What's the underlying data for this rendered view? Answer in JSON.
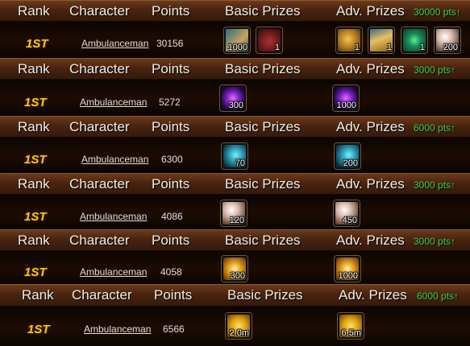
{
  "sections": [
    {
      "header": {
        "rank": "Rank",
        "character": "Character",
        "points": "Points",
        "basic": "Basic Prizes",
        "adv": "Adv. Prizes",
        "threshold": "30000 pts↑"
      },
      "entry": {
        "rank": "1ST",
        "character": "Ambulanceman",
        "points": "30156"
      },
      "basic_prizes": [
        {
          "icon": "scroll-icon",
          "qty": "1000"
        },
        {
          "icon": "chest-icon",
          "qty": "1"
        }
      ],
      "adv_prizes": [
        {
          "icon": "lion-icon",
          "qty": "1"
        },
        {
          "icon": "gold-scroll-icon",
          "qty": "1"
        },
        {
          "icon": "gem-icon",
          "qty": "1"
        },
        {
          "icon": "pearl-icon",
          "qty": "200"
        }
      ]
    },
    {
      "header": {
        "rank": "Rank",
        "character": "Character",
        "points": "Points",
        "basic": "Basic Prizes",
        "adv": "Adv. Prizes",
        "threshold": "3000 pts↑"
      },
      "entry": {
        "rank": "1ST",
        "character": "Ambulanceman",
        "points": "5272"
      },
      "basic_prizes": [
        {
          "icon": "orb-icon",
          "qty": "300"
        }
      ],
      "adv_prizes": [
        {
          "icon": "orb-icon",
          "qty": "1000"
        }
      ]
    },
    {
      "header": {
        "rank": "Rank",
        "character": "Character",
        "points": "Points",
        "basic": "Basic Prizes",
        "adv": "Adv. Prizes",
        "threshold": "6000 pts↑"
      },
      "entry": {
        "rank": "1ST",
        "character": "Ambulanceman",
        "points": "6300"
      },
      "basic_prizes": [
        {
          "icon": "potion-icon",
          "qty": "70"
        }
      ],
      "adv_prizes": [
        {
          "icon": "potion-icon",
          "qty": "200"
        }
      ]
    },
    {
      "header": {
        "rank": "Rank",
        "character": "Character",
        "points": "Points",
        "basic": "Basic Prizes",
        "adv": "Adv. Prizes",
        "threshold": "3000 pts↑"
      },
      "entry": {
        "rank": "1ST",
        "character": "Ambulanceman",
        "points": "4086"
      },
      "basic_prizes": [
        {
          "icon": "pearl-icon",
          "qty": "120"
        }
      ],
      "adv_prizes": [
        {
          "icon": "pearl-icon",
          "qty": "450"
        }
      ]
    },
    {
      "header": {
        "rank": "Rank",
        "character": "Character",
        "points": "Points",
        "basic": "Basic Prizes",
        "adv": "Adv. Prizes",
        "threshold": "3000 pts↑"
      },
      "entry": {
        "rank": "1ST",
        "character": "Ambulanceman",
        "points": "4058"
      },
      "basic_prizes": [
        {
          "icon": "token-icon",
          "qty": "300"
        }
      ],
      "adv_prizes": [
        {
          "icon": "token-icon",
          "qty": "1000"
        }
      ]
    },
    {
      "header": {
        "rank": "Rank",
        "character": "Character",
        "points": "Points",
        "basic": "Basic Prizes",
        "adv": "Adv. Prizes",
        "threshold": "6000 pts↑"
      },
      "entry": {
        "rank": "1ST",
        "character": "Ambulanceman",
        "points": "6566"
      },
      "basic_prizes": [
        {
          "icon": "gold-coin-icon",
          "qty": "2.0m"
        }
      ],
      "adv_prizes": [
        {
          "icon": "gold-coin-icon",
          "qty": "6.5m"
        }
      ]
    }
  ],
  "colors": {
    "threshold": "#3cd24a",
    "rank_gold": "#f5c919",
    "header_bg": "#4a2410"
  }
}
